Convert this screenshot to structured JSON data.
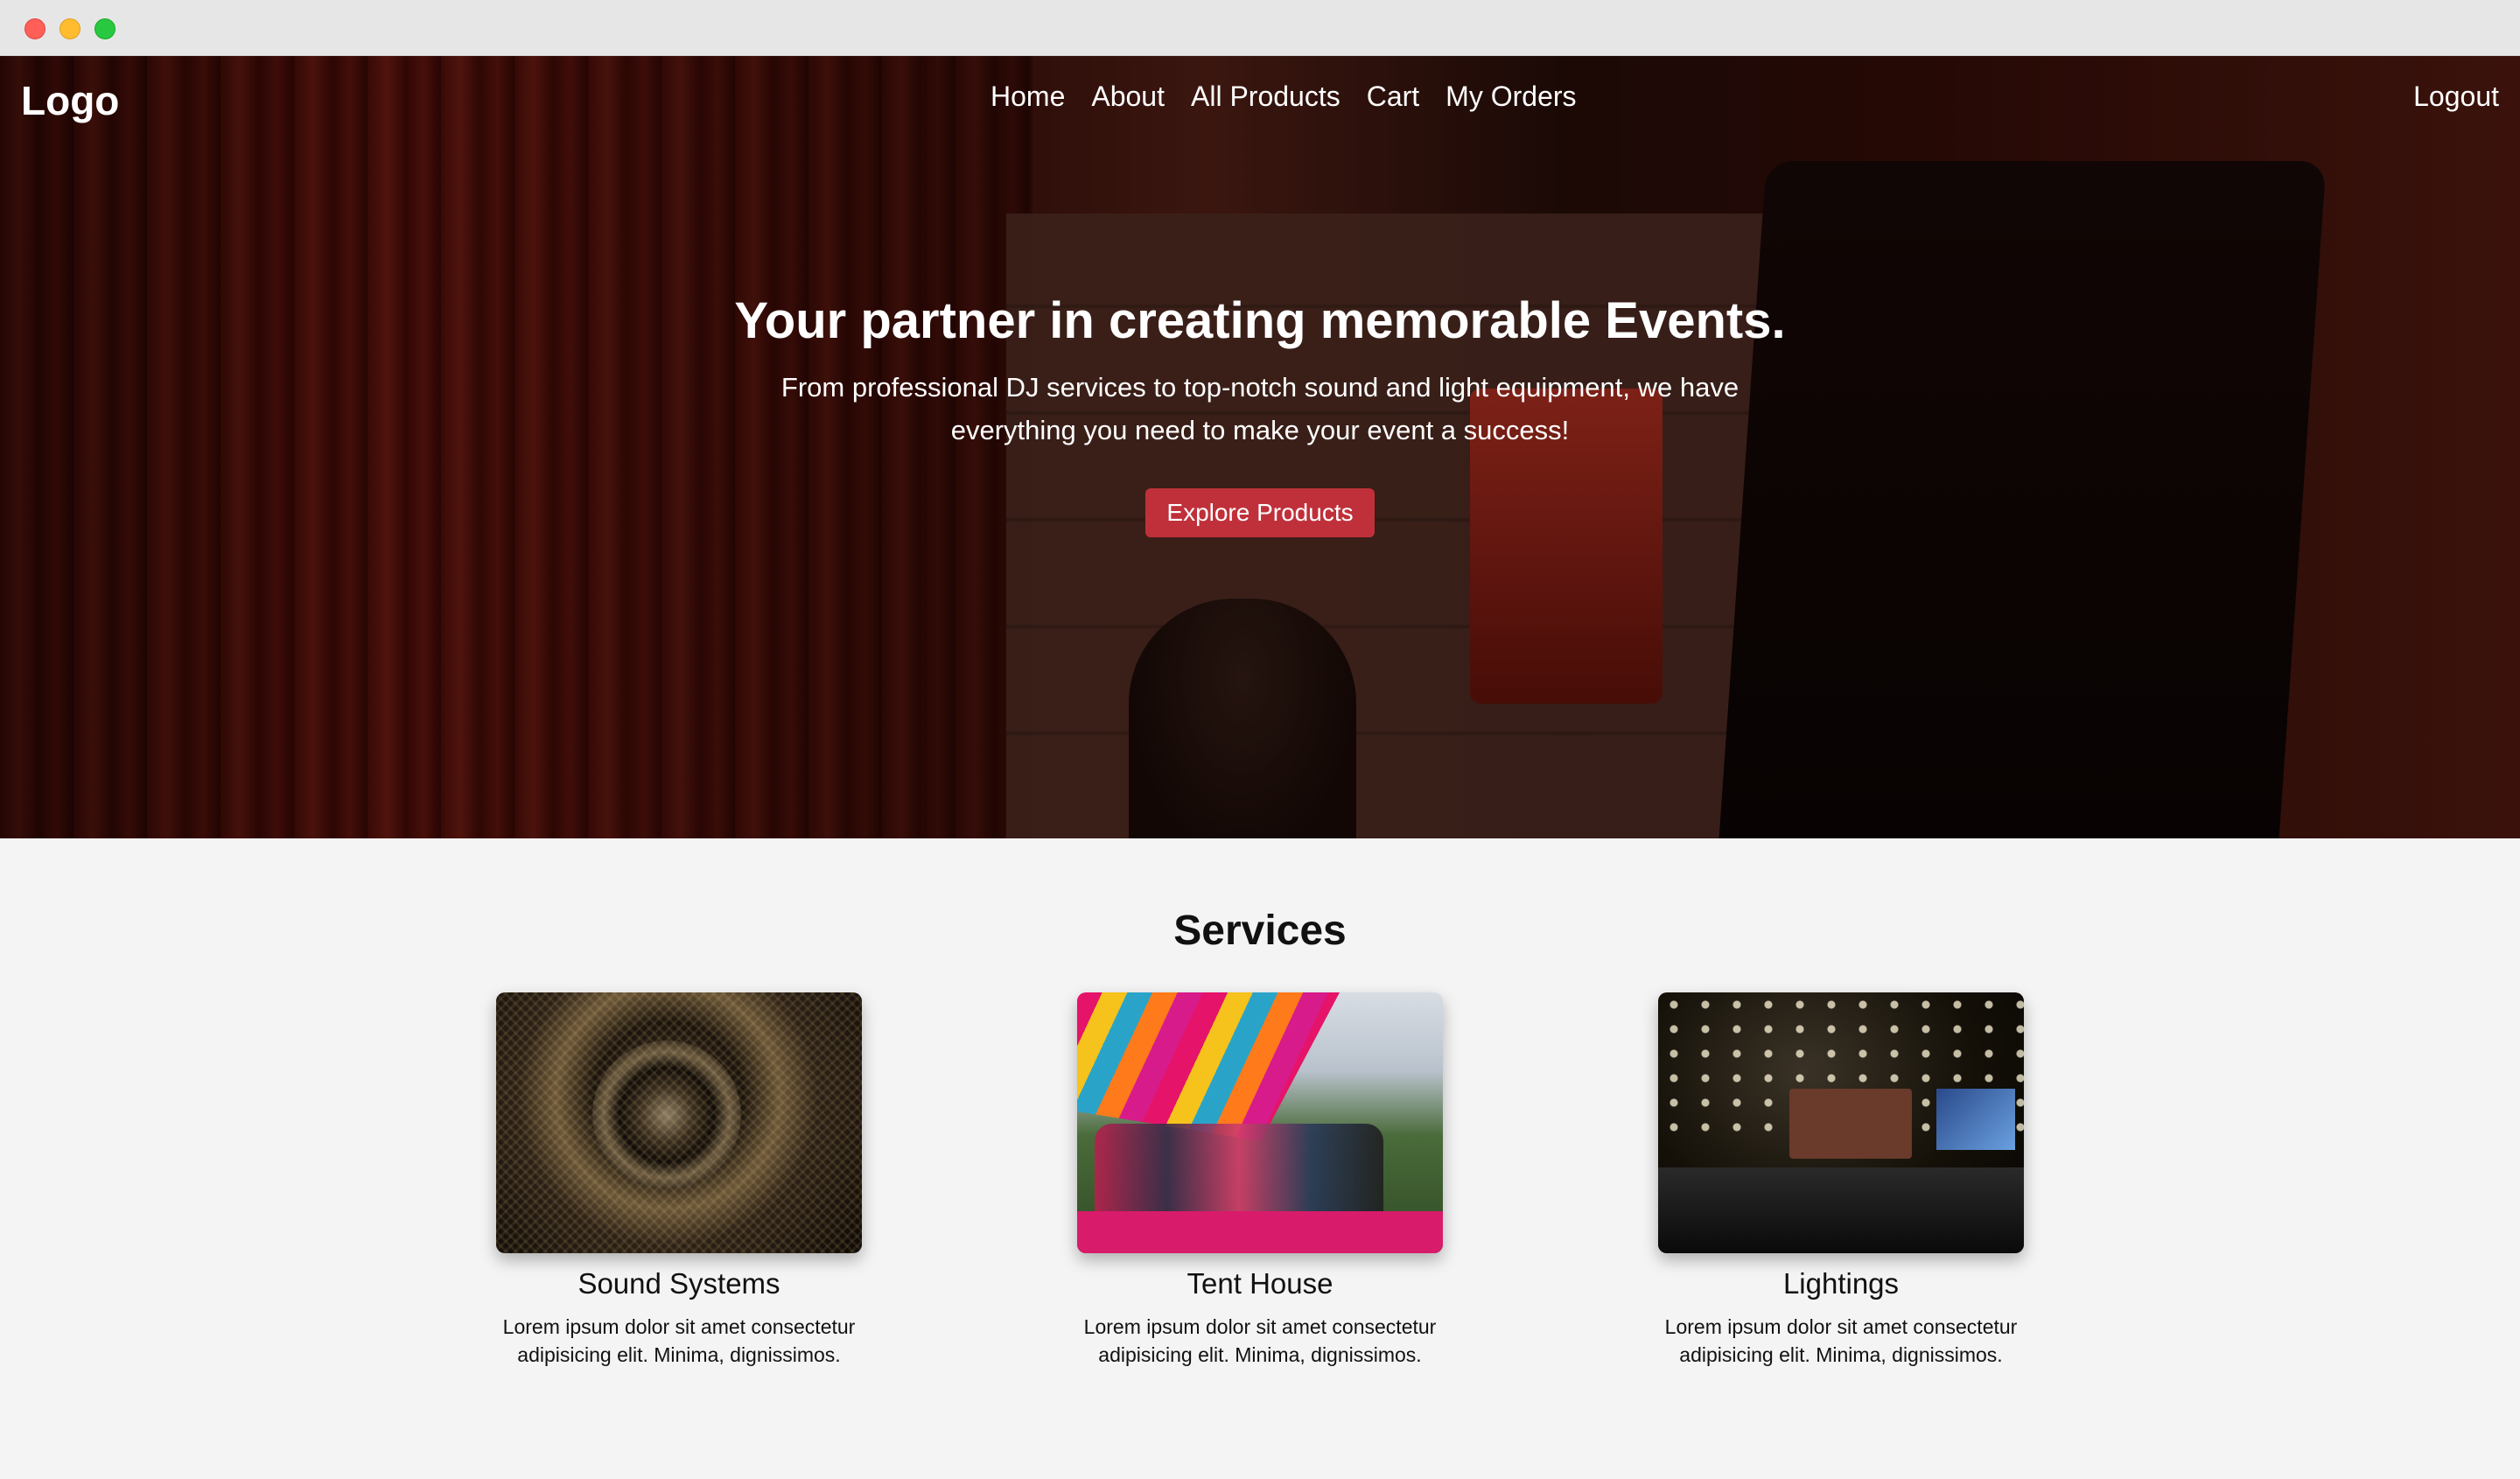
{
  "nav": {
    "logo": "Logo",
    "links": [
      "Home",
      "About",
      "All Products",
      "Cart",
      "My Orders"
    ],
    "logout": "Logout"
  },
  "hero": {
    "title": "Your partner in creating memorable Events.",
    "subtitle": "From professional DJ services to top-notch sound and light equipment, we have everything you need to make your event a success!",
    "button": "Explore Products"
  },
  "services": {
    "title": "Services",
    "items": [
      {
        "name": "Sound Systems",
        "desc": "Lorem ipsum dolor sit amet consectetur adipisicing elit. Minima, dignissimos."
      },
      {
        "name": "Tent House",
        "desc": "Lorem ipsum dolor sit amet consectetur adipisicing elit. Minima, dignissimos."
      },
      {
        "name": "Lightings",
        "desc": "Lorem ipsum dolor sit amet consectetur adipisicing elit. Minima, dignissimos."
      }
    ]
  },
  "colors": {
    "accent_button": "#c0303a",
    "page_background": "#f4f4f4"
  }
}
